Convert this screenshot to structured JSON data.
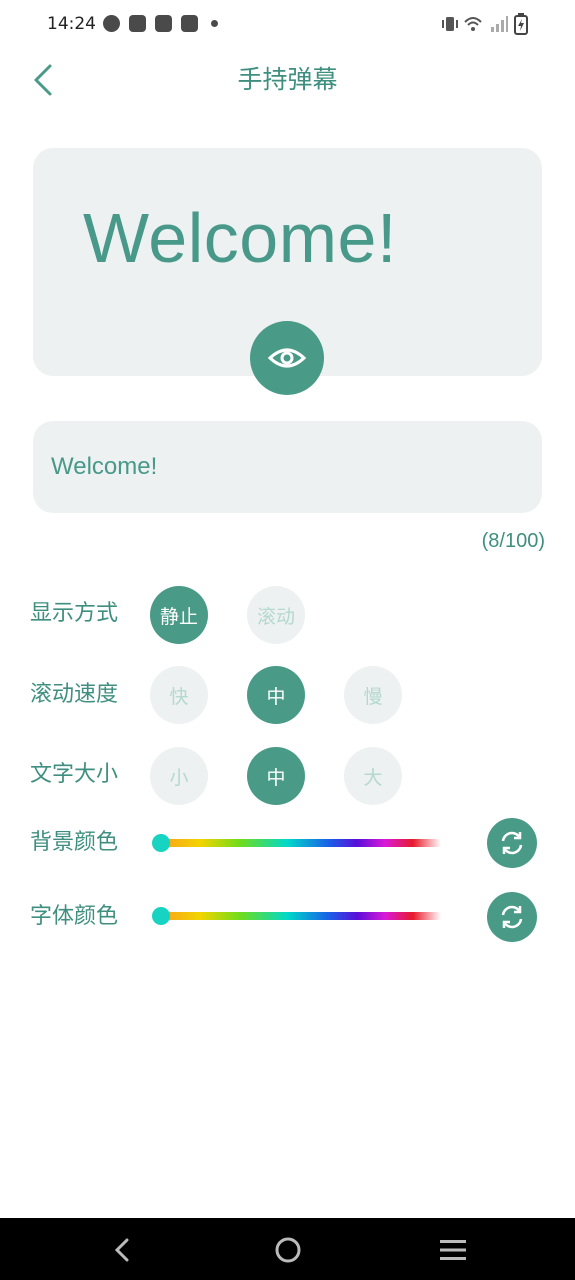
{
  "status_bar": {
    "time": "14:24",
    "icons": [
      "gauge-icon",
      "bag-icon",
      "bag-icon",
      "bag-icon",
      "dot-icon",
      "vibrate-icon",
      "wifi-icon",
      "signal-icon",
      "battery-charging-icon"
    ]
  },
  "header": {
    "title": "手持弹幕",
    "back_icon": "chevron-left-icon"
  },
  "preview": {
    "text": "Welcome!",
    "eye_icon": "eye-icon"
  },
  "input": {
    "value": "Welcome!",
    "counter": "(8/100)"
  },
  "display_mode": {
    "label": "显示方式",
    "options": [
      "静止",
      "滚动"
    ],
    "selected": "静止"
  },
  "scroll_speed": {
    "label": "滚动速度",
    "options": [
      "快",
      "中",
      "慢"
    ],
    "selected": "中"
  },
  "text_size": {
    "label": "文字大小",
    "options": [
      "小",
      "中",
      "大"
    ],
    "selected": "中"
  },
  "background_color": {
    "label": "背景颜色",
    "slider_value": 0,
    "refresh_icon": "refresh-icon"
  },
  "font_color": {
    "label": "字体颜色",
    "slider_value": 0,
    "refresh_icon": "refresh-icon"
  },
  "colors": {
    "accent": "#4a9a88",
    "title_text": "#3f8f80",
    "card_bg": "#edf1f1",
    "inactive_text": "#b5d8cf",
    "thumb": "#17d4c2"
  },
  "nav_bar": {
    "icons": [
      "nav-back-icon",
      "nav-home-icon",
      "nav-menu-icon"
    ]
  }
}
